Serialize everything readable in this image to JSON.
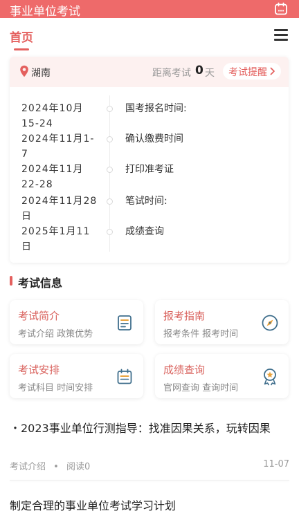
{
  "app": {
    "title": "事业单位考试"
  },
  "nav": {
    "home_tab": "首页"
  },
  "exam_card": {
    "region": "湖南",
    "countdown_label": "距离考试",
    "countdown_days": "0",
    "countdown_unit": "天",
    "remind_label": "考试提醒",
    "schedule": [
      {
        "date": "2024年10月15-24",
        "event": "国考报名时间:"
      },
      {
        "date": "2024年11月1-7",
        "event": "确认缴费时间"
      },
      {
        "date": "2024年11月22-28",
        "event": "打印准考证"
      },
      {
        "date": "2024年11月28日",
        "event": "笔试时间:"
      },
      {
        "date": "2025年1月11日",
        "event": "成绩查询"
      }
    ]
  },
  "section": {
    "title": "考试信息"
  },
  "tiles": [
    {
      "title": "考试简介",
      "subtitle": "考试介绍 政策优势",
      "icon": "document-icon"
    },
    {
      "title": "报考指南",
      "subtitle": "报考条件 报考时间",
      "icon": "compass-icon"
    },
    {
      "title": "考试安排",
      "subtitle": "考试科目 时间安排",
      "icon": "calendar-icon"
    },
    {
      "title": "成绩查询",
      "subtitle": "官网查询 查询时间",
      "icon": "award-icon"
    }
  ],
  "articles": [
    {
      "title": "・2023事业单位行测指导：找准因果关系，玩转因果",
      "category": "考试介绍",
      "reads": "阅读0",
      "date": "11-07"
    },
    {
      "title": "制定合理的事业单位考试学习计划"
    }
  ],
  "colors": {
    "primary": "#ee6a6a",
    "accent": "#e4605e",
    "icon_blue": "#3f6e8c"
  }
}
